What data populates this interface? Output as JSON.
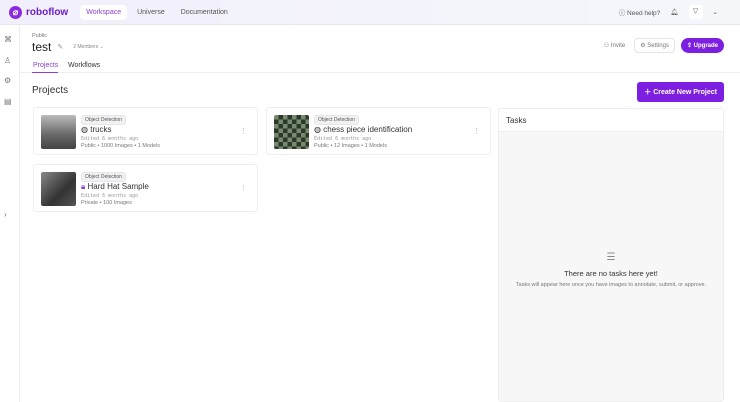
{
  "topbar": {
    "brand": "roboflow",
    "nav": [
      "Workspace",
      "Universe",
      "Documentation"
    ],
    "help": "Need help?"
  },
  "workspace": {
    "visibility": "Public",
    "name": "test",
    "members": "2 Members",
    "invite": "Invite",
    "settings": "Settings",
    "upgrade": "Upgrade"
  },
  "tabs": [
    "Projects",
    "Workflows"
  ],
  "projects": {
    "heading": "Projects",
    "create": "Create New Project",
    "items": [
      {
        "type": "Object Detection",
        "name": "trucks",
        "edited": "Edited 6 months ago",
        "meta": "Public • 1000 Images • 1 Models"
      },
      {
        "type": "Object Detection",
        "name": "chess piece identification",
        "edited": "Edited 6 months ago",
        "meta": "Public • 12 Images • 1 Models"
      },
      {
        "type": "Object Detection",
        "name": "Hard Hat Sample",
        "edited": "Edited 6 months ago",
        "meta": "Private • 100 Images"
      }
    ]
  },
  "tasks": {
    "title": "Tasks",
    "empty_title": "There are no tasks here yet!",
    "empty_desc": "Tasks will appear here once you have images to annotate, submit, or approve."
  }
}
